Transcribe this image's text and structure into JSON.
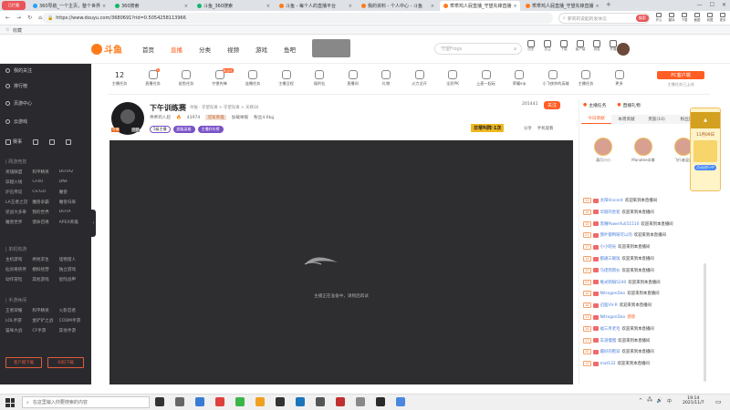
{
  "browser": {
    "tabs": [
      {
        "label": "360导航_一个主页，整个世界",
        "color": "#2aa0f7"
      },
      {
        "label": "360搜索",
        "color": "#12b86a"
      },
      {
        "label": "斗鱼_360搜索",
        "color": "#12b86a"
      },
      {
        "label": "斗鱼 - 每个人的直播平台",
        "color": "#ff7a1a"
      },
      {
        "label": "我的资料 - 个人中心 - 斗鱼",
        "color": "#ff7a1a"
      },
      {
        "label": "乖乖鸡人屁直播_守望先锋直播",
        "color": "#ff7a1a"
      },
      {
        "label": "乖乖鸡人屁直播_守望先锋直播",
        "color": "#ff7a1a"
      }
    ],
    "logo_badge": "已拦截",
    "address": "https://www.douyu.com/3680691?rid=0.5054258113966",
    "search_placeholder": "萝莉莉说起的发体信",
    "search_btn": "搜索",
    "toolbar_labels": [
      "开心",
      "翻译",
      "下载",
      "截图",
      "收藏",
      "更多"
    ],
    "bookmark": "收藏"
  },
  "site": {
    "logo_text": "斗鱼",
    "nav": [
      "首页",
      "直播",
      "分类",
      "视频",
      "游戏",
      "鱼吧"
    ],
    "nav_active_color": "#ff5d23",
    "search_placeholder": "守望Frogs",
    "top_icons": [
      "历史",
      "关注",
      "下载",
      "客户端",
      "消息",
      "开播"
    ]
  },
  "categories": [
    {
      "label": "主播任务",
      "count": "12"
    },
    {
      "label": "直播任务",
      "badge": "3"
    },
    {
      "label": "鲨鱼任务",
      "badge": ""
    },
    {
      "label": "守望先锋",
      "badge": "新活动"
    },
    {
      "label": "连播任务"
    },
    {
      "label": "主播日程"
    },
    {
      "label": "福利社"
    },
    {
      "label": "直播间"
    },
    {
      "label": "礼物"
    },
    {
      "label": "火力全开"
    },
    {
      "label": "全民PK"
    },
    {
      "label": "上麦一起玩"
    },
    {
      "label": "荣耀vip"
    },
    {
      "label": "小飞侠你的英雄"
    },
    {
      "label": "主播任务"
    },
    {
      "label": "更多"
    }
  ],
  "pc_client": {
    "label": "PC客户端",
    "sub": "主播任务已上线"
  },
  "sidebar": {
    "top_items": [
      "我的关注",
      "排行榜",
      "页游中心",
      "云游戏"
    ],
    "icons_row": [
      "赛事",
      "",
      "",
      ""
    ],
    "section1": {
      "title": "| 网游竞技",
      "items": [
        "英雄联盟",
        "和平精英",
        "DOTA2",
        "穿越火线",
        "CF40",
        "DNF",
        "炉石传说",
        "CS:GO",
        "魔兽",
        "LA王者之冠",
        "魔兽争霸",
        "魔兽归来",
        "逆战大多拳",
        "我的世界",
        "DOTA",
        "魔兽世界",
        "使命召唤",
        "APEX英雄"
      ]
    },
    "section2": {
      "title": "| 单机热游",
      "items": [
        "主机游戏",
        "绝地求生",
        "怪物猎人",
        "仙剑奇侠传",
        "模拟经营",
        "独立游戏",
        "动作冒险",
        "其他游戏",
        "星际战甲"
      ]
    },
    "section3": {
      "title": "| 手游休闲",
      "items": [
        "王者荣耀",
        "和平精英",
        "火影忍者",
        "LOL手游",
        "金铲铲之战",
        "CODM手游",
        "猫咪大战",
        "CF手游",
        "其他手游"
      ]
    },
    "footer": [
      "客户端下载",
      "扫码下载"
    ]
  },
  "room": {
    "title": "下午训练赛",
    "sub": "举报 · 守望先锋 > 守望先锋 > 天梯30",
    "streamer": "乖乖鸡人屁",
    "hot": "43974",
    "medal": "冠军英雄",
    "report": "加载举报",
    "fans": "粉丝4.6kg",
    "follow_count": "201441",
    "follow_btn": "关注",
    "share": "分享",
    "mobile": "手机观看",
    "tags": [
      "5级主播",
      "超级英雄",
      "主播好价榜"
    ],
    "promo": "日常叫阵·1次",
    "loading_text": "主播正在准备中，请稍后再试",
    "avatar_label": "尽情"
  },
  "right": {
    "title": "主播任务",
    "title2": "直播礼物",
    "tabs": [
      "今日贡献",
      "本周贡献",
      "贵族(10)",
      "粉丝团"
    ],
    "top3": [
      {
        "name": "满月小小"
      },
      {
        "name": "Manatee本尊"
      },
      {
        "name": "飞行者混血"
      }
    ],
    "event_title": "11月09日",
    "event_sub": "活动进行中",
    "chats": [
      {
        "lv": "11",
        "name": "太阳Vincent",
        "msg": "欢迎来到本直播间"
      },
      {
        "lv": "19",
        "name": "华丽的金客",
        "msg": "欢迎来到本直播间"
      },
      {
        "lv": "15",
        "name": "黑曜Powerfuli51510",
        "msg": "欢迎来到本直播间"
      },
      {
        "lv": "21",
        "name": "我叶都鸭呀可以的",
        "msg": "欢迎来到本直播间"
      },
      {
        "lv": "17",
        "name": "小小明光",
        "msg": "欢迎来到本直播间"
      },
      {
        "lv": "14",
        "name": "都通三碗饭",
        "msg": "欢迎来到本直播间"
      },
      {
        "lv": "12",
        "name": "马佬而而伙",
        "msg": "欢迎来到本直播间"
      },
      {
        "lv": "23",
        "name": "唯光明锅5240",
        "msg": "欢迎来到本直播间"
      },
      {
        "lv": "10",
        "name": "NitrogenDan",
        "msg": "欢迎来到本直播间"
      },
      {
        "lv": "16",
        "name": "迅猛VV-R",
        "msg": "欢迎来到本直播间"
      },
      {
        "lv": "13",
        "name": "NitrogenDan",
        "msg": "感冒"
      },
      {
        "lv": "18",
        "name": "福三月老毛",
        "msg": "欢迎来到本直播间"
      },
      {
        "lv": "11",
        "name": "车道慢慢",
        "msg": "欢迎来到本直播间"
      },
      {
        "lv": "20",
        "name": "最好的鞋穿",
        "msg": "欢迎来到本直播间"
      },
      {
        "lv": "12",
        "name": "mat132",
        "msg": "欢迎来到本直播间"
      }
    ]
  },
  "taskbar": {
    "search_placeholder": "在这里输入你要搜索的内容",
    "time": "19:14",
    "date": "2021/11/7",
    "lang": "中"
  }
}
